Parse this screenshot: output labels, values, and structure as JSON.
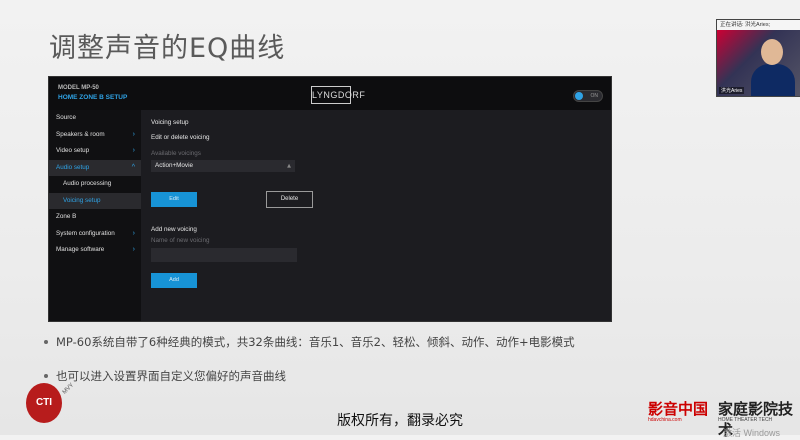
{
  "slide": {
    "title": "调整声音的EQ曲线",
    "bullets": [
      "MP-60系统自带了6种经典的模式，共32条曲线：音乐1、音乐2、轻松、倾斜、动作、动作+电影模式",
      "也可以进入设置界面自定义您偏好的声音曲线"
    ],
    "subtitle": "版权所有，翻录必究",
    "watermark": "激活 Windows"
  },
  "device_ui": {
    "model": "MODEL MP-50",
    "breadcrumb": "HOME  ZONE B  SETUP",
    "brand": "LYNGDORF",
    "power_label": "ON",
    "sidebar": [
      {
        "label": "Source",
        "chevron": ""
      },
      {
        "label": "Speakers & room",
        "chevron": "›"
      },
      {
        "label": "Video setup",
        "chevron": "›"
      },
      {
        "label": "Audio setup",
        "chevron": "^"
      },
      {
        "label": "Audio processing",
        "chevron": ""
      },
      {
        "label": "Voicing setup",
        "chevron": ""
      },
      {
        "label": "Zone B",
        "chevron": ""
      },
      {
        "label": "System configuration",
        "chevron": "›"
      },
      {
        "label": "Manage software",
        "chevron": "›"
      }
    ],
    "content": {
      "heading": "Voicing setup",
      "edit_section": "Edit or delete voicing",
      "available_label": "Available voicings",
      "selected_voicing": "Action+Movie",
      "edit_button": "Edit",
      "delete_button": "Delete",
      "add_section": "Add new voicing",
      "new_name_label": "Name of new voicing",
      "new_name_value": "",
      "add_button": "Add"
    }
  },
  "video": {
    "status": "正在讲话: 洪光Aries;",
    "name": "洪光Aries"
  },
  "logos": {
    "cti": "CTI",
    "cti_tag": "MVY",
    "sponsor1": "影音中国",
    "sponsor1_url": "hdavchina.com",
    "sponsor2": "家庭影院技术",
    "sponsor2_tag": "HOME THEATER TECH"
  }
}
